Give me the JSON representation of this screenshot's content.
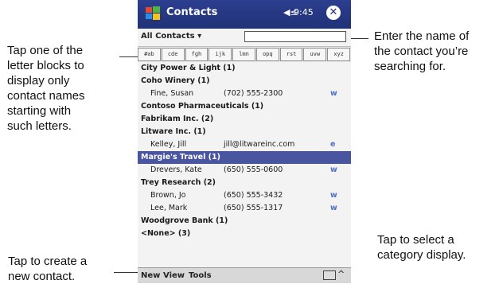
{
  "callouts": {
    "letters": "Tap one of the\nletter blocks to\ndisplay only\ncontact names\nstarting with\nsuch letters.",
    "search": "Enter the name of\nthe  contact you’re\nsearching for.",
    "new": "Tap to create a\nnew contact.",
    "category": "Tap to select a\ncategory display."
  },
  "titlebar": {
    "title": "Contacts",
    "volume": "◀≤",
    "time": "9:45",
    "close": "✕",
    "icon": "windows-flag-icon"
  },
  "filter": {
    "label": "All Contacts ▾",
    "search_value": ""
  },
  "letters": [
    "#ab",
    "cde",
    "fgh",
    "ijk",
    "lmn",
    "opq",
    "rst",
    "uvw",
    "xyz"
  ],
  "rows": [
    {
      "type": "group",
      "text": "City Power & Light (1)"
    },
    {
      "type": "group",
      "text": "Coho Winery (1)"
    },
    {
      "type": "contact",
      "name": "Fine, Susan",
      "value": "(702) 555-2300",
      "tag": "w"
    },
    {
      "type": "group",
      "text": "Contoso Pharmaceuticals (1)"
    },
    {
      "type": "group",
      "text": "Fabrikam Inc. (2)"
    },
    {
      "type": "group",
      "text": "Litware Inc. (1)"
    },
    {
      "type": "contact",
      "name": "Kelley, Jill",
      "value": "jill@litwareinc.com",
      "tag": "e"
    },
    {
      "type": "selected",
      "text": "Margie's Travel (1)"
    },
    {
      "type": "contact",
      "name": "Drevers, Kate",
      "value": "(650) 555-0600",
      "tag": "w"
    },
    {
      "type": "group",
      "text": "Trey Research (2)"
    },
    {
      "type": "contact",
      "name": "Brown, Jo",
      "value": "(650) 555-3432",
      "tag": "w"
    },
    {
      "type": "contact",
      "name": "Lee, Mark",
      "value": "(650) 555-1317",
      "tag": "w"
    },
    {
      "type": "group",
      "text": "Woodgrove Bank (1)"
    },
    {
      "type": "group",
      "text": "<None> (3)"
    }
  ],
  "menubar": {
    "new": "New",
    "view": "View",
    "tools": "Tools",
    "input": "keyboard-icon",
    "arrow": "^"
  },
  "colors": {
    "titlebar": "#203277",
    "selected": "#4a55a0",
    "tag": "#4f6ec8"
  }
}
